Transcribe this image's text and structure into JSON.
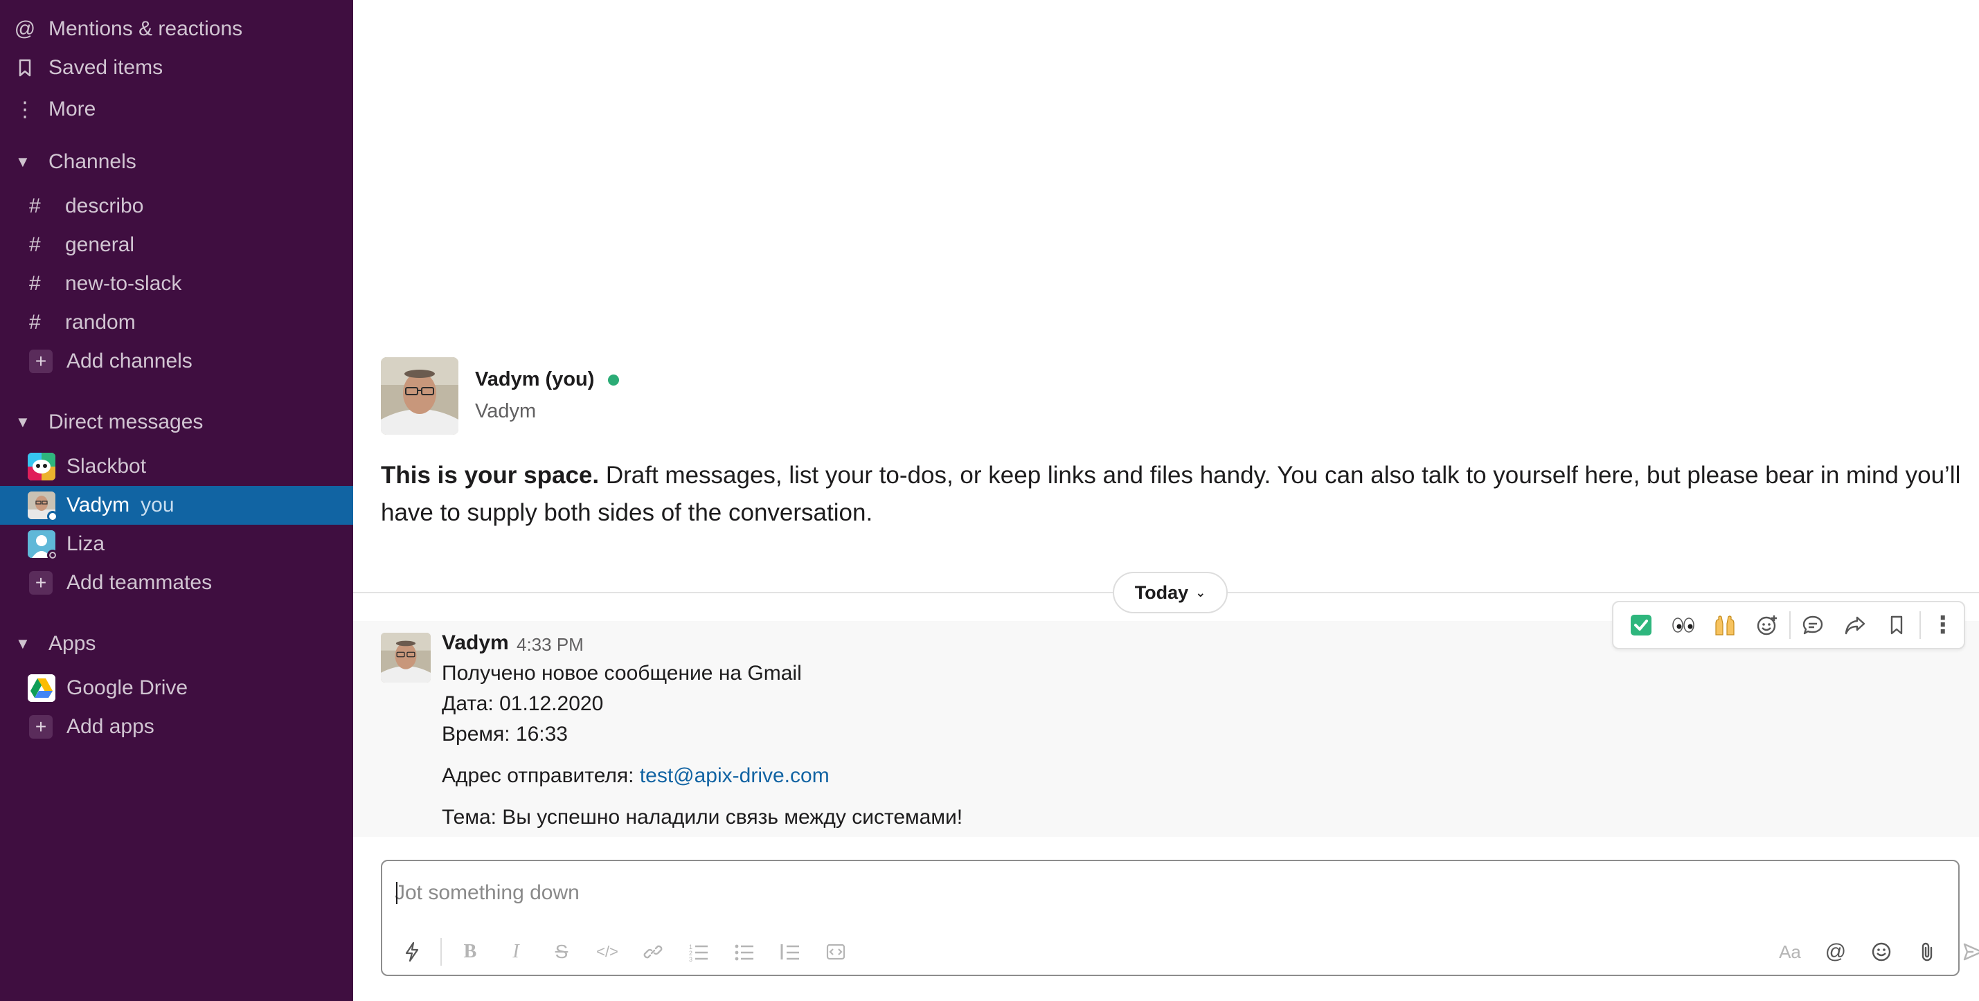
{
  "sidebar": {
    "top_items": [
      {
        "label": "Mentions & reactions",
        "icon": "at-icon"
      },
      {
        "label": "Saved items",
        "icon": "bookmark-icon"
      },
      {
        "label": "More",
        "icon": "more-vertical-icon"
      }
    ],
    "channels_header": "Channels",
    "channels": [
      "describo",
      "general",
      "new-to-slack",
      "random"
    ],
    "add_channels": "Add channels",
    "dm_header": "Direct messages",
    "dms": [
      {
        "label": "Slackbot"
      },
      {
        "label": "Vadym",
        "suffix": "you"
      },
      {
        "label": "Liza"
      }
    ],
    "add_teammates": "Add teammates",
    "apps_header": "Apps",
    "apps": [
      {
        "label": "Google Drive"
      }
    ],
    "add_apps": "Add apps",
    "colors": {
      "background": "#3f0e40",
      "selected": "#1164a3"
    }
  },
  "intro": {
    "name": "Vadym (you)",
    "subtitle": "Vadym",
    "bold_text": "This is your space.",
    "text": " Draft messages, list your to-dos, or keep links and files handy. You can also talk to yourself here, but please bear in mind you’ll have to supply both sides of the conversation."
  },
  "divider": {
    "label": "Today"
  },
  "message": {
    "author": "Vadym",
    "time": "4:33 PM",
    "line1": "Получено новое сообщение на Gmail",
    "line2": "Дата: 01.12.2020",
    "line3": "Время: 16:33",
    "sender_label": "Адрес отправителя: ",
    "sender_email": "test@apix-drive.com",
    "subject": "Тема: Вы успешно наладили связь между системами!"
  },
  "message_actions": [
    "check-mark-emoji",
    "eyes-emoji",
    "raised-hands-emoji",
    "add-reaction-icon",
    "reply-thread-icon",
    "share-icon",
    "bookmark-icon",
    "more-actions-icon"
  ],
  "composer": {
    "placeholder": "Jot something down",
    "value": ""
  }
}
